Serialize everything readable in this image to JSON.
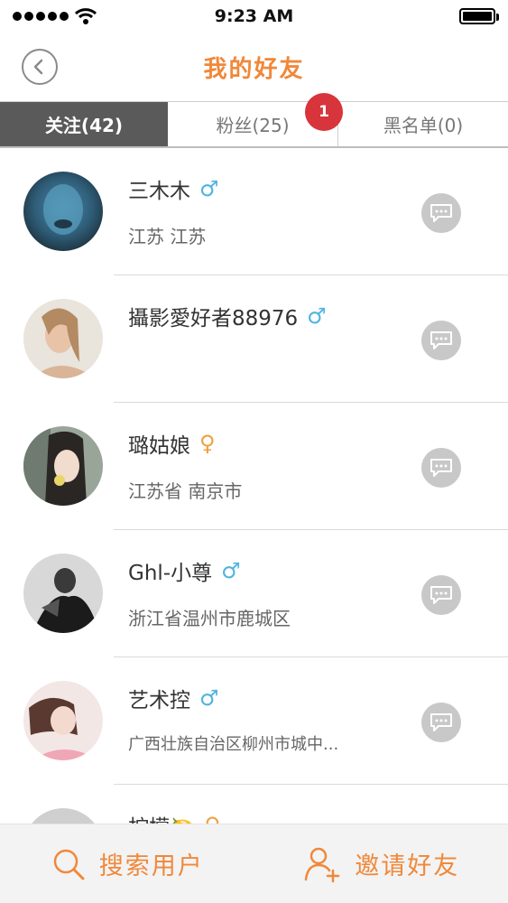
{
  "status_bar": {
    "time": "9:23 AM",
    "signal_dots": 5
  },
  "header": {
    "title": "我的好友"
  },
  "tabs": [
    {
      "label": "关注(42)",
      "active": true
    },
    {
      "label": "粉丝(25)",
      "active": false
    },
    {
      "label": "黑名单(0)",
      "active": false
    }
  ],
  "badge": {
    "count": "1"
  },
  "contacts": [
    {
      "name": "三木木",
      "gender": "male",
      "gender_symbol": "♂",
      "region": "江苏 江苏"
    },
    {
      "name": "攝影愛好者88976",
      "gender": "male",
      "gender_symbol": "♂",
      "region": ""
    },
    {
      "name": "璐姑娘",
      "gender": "female",
      "gender_symbol": "♀",
      "region": "江苏省 南京市"
    },
    {
      "name": "Ghl-小尊",
      "gender": "male",
      "gender_symbol": "♂",
      "region": "浙江省温州市鹿城区"
    },
    {
      "name": "艺术控",
      "gender": "male",
      "gender_symbol": "♂",
      "region": "广西壮族自治区柳州市城中..."
    },
    {
      "name": "柠檬🍋",
      "gender": "female",
      "gender_symbol": "♀",
      "region": ""
    }
  ],
  "bottom_bar": {
    "search_label": "搜索用户",
    "invite_label": "邀请好友"
  },
  "colors": {
    "accent": "#f0883a",
    "male": "#4fb4e0",
    "female": "#f0a040",
    "badge": "#d7343c",
    "tab_active": "#5a5a5a"
  },
  "icons": {
    "back": "back-chevron-icon",
    "chat": "chat-bubble-icon",
    "search": "search-icon",
    "invite": "add-user-icon"
  }
}
